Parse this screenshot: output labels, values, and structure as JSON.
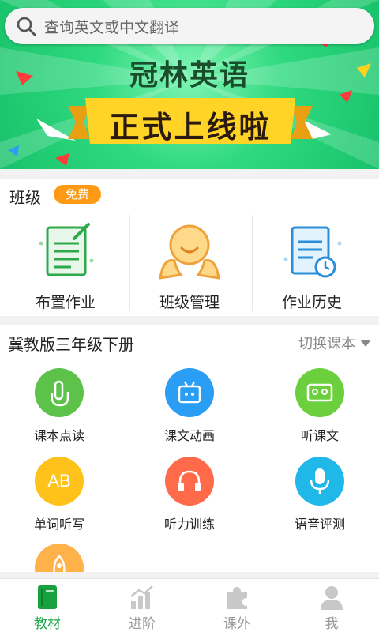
{
  "search": {
    "placeholder": "查询英文或中文翻译"
  },
  "banner": {
    "title": "冠林英语",
    "subtitle": "正式上线啦"
  },
  "class_section": {
    "title": "班级",
    "badge": "免费",
    "items": [
      {
        "label": "布置作业",
        "icon": "assign-homework-icon"
      },
      {
        "label": "班级管理",
        "icon": "class-manage-icon"
      },
      {
        "label": "作业历史",
        "icon": "homework-history-icon"
      }
    ]
  },
  "book_section": {
    "title": "冀教版三年级下册",
    "switch_label": "切换课本",
    "features": [
      {
        "label": "课本点读",
        "icon": "tap-read-icon",
        "color": "#5cc24a"
      },
      {
        "label": "课文动画",
        "icon": "animation-icon",
        "color": "#2a9df4"
      },
      {
        "label": "听课文",
        "icon": "tape-icon",
        "color": "#6ccf3e"
      },
      {
        "label": "单词听写",
        "icon": "ab-icon",
        "color": "#ffc21a"
      },
      {
        "label": "听力训练",
        "icon": "headphone-icon",
        "color": "#ff6a4a"
      },
      {
        "label": "语音评测",
        "icon": "microphone-icon",
        "color": "#1fb8e8"
      }
    ]
  },
  "nav": {
    "items": [
      {
        "label": "教材",
        "icon": "book-icon",
        "active": true
      },
      {
        "label": "进阶",
        "icon": "chart-icon",
        "active": false
      },
      {
        "label": "课外",
        "icon": "puzzle-icon",
        "active": false
      },
      {
        "label": "我",
        "icon": "user-icon",
        "active": false
      }
    ]
  },
  "colors": {
    "accent": "#18a23f",
    "badge": "#ff9a17",
    "banner": "#2fd97f"
  }
}
